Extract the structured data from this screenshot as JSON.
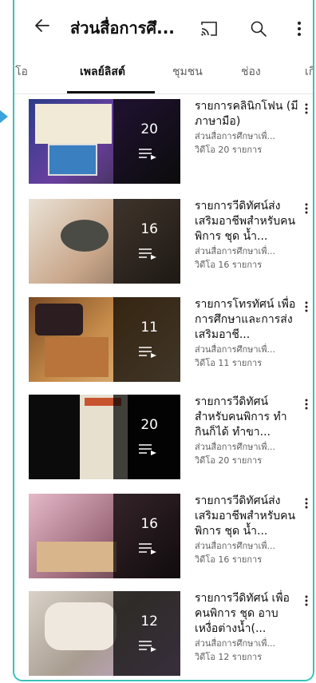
{
  "header": {
    "back_icon": "arrow-left-icon",
    "title": "ส่วนสื่อการศึ...",
    "cast_icon": "cast-icon",
    "search_icon": "search-icon",
    "more_icon": "more-vertical-icon"
  },
  "tabs": [
    {
      "label": "วิดีโอ",
      "active": false
    },
    {
      "label": "เพลย์ลิสต์",
      "active": true
    },
    {
      "label": "ชุมชน",
      "active": false
    },
    {
      "label": "ช่อง",
      "active": false
    },
    {
      "label": "เกี่",
      "active": false
    }
  ],
  "playlists": [
    {
      "title": "รายการคลินิกโฟน (มีภาษามือ)",
      "channel": "ส่วนสื่อการศึกษาเพื่...",
      "videos": "วิดีโอ 20 รายการ",
      "count": "20"
    },
    {
      "title": "รายการวีดิทัศน์ส่งเสริมอาชีพสำหรับคนพิการ ชุด น้ำ...",
      "channel": "ส่วนสื่อการศึกษาเพื่...",
      "videos": "วิดีโอ 16 รายการ",
      "count": "16"
    },
    {
      "title": "รายการโทรทัศน์ เพื่อการศึกษาและการส่งเสริมอาชี...",
      "channel": "ส่วนสื่อการศึกษาเพื่...",
      "videos": "วิดีโอ 11 รายการ",
      "count": "11"
    },
    {
      "title": "รายการวีดิทัศน์ สำหรับคนพิการ ทำกินก็ได้ ทำขา...",
      "channel": "ส่วนสื่อการศึกษาเพื่...",
      "videos": "วิดีโอ 20 รายการ",
      "count": "20"
    },
    {
      "title": "รายการวีดิทัศน์ส่งเสริมอาชีพสำหรับคนพิการ ชุด น้ำ...",
      "channel": "ส่วนสื่อการศึกษาเพื่...",
      "videos": "วิดีโอ 16 รายการ",
      "count": "16"
    },
    {
      "title": "รายการวีดิทัศน์ เพื่อคนพิการ ชุด อาบเหงื่อต่างน้ำ(...",
      "channel": "ส่วนสื่อการศึกษาเพื่...",
      "videos": "วิดีโอ 12 รายการ",
      "count": "12"
    }
  ],
  "colors": {
    "frame": "#3cc2b8",
    "marker": "#3aa3d9",
    "text": "#0f0f0f",
    "muted": "#606060"
  }
}
